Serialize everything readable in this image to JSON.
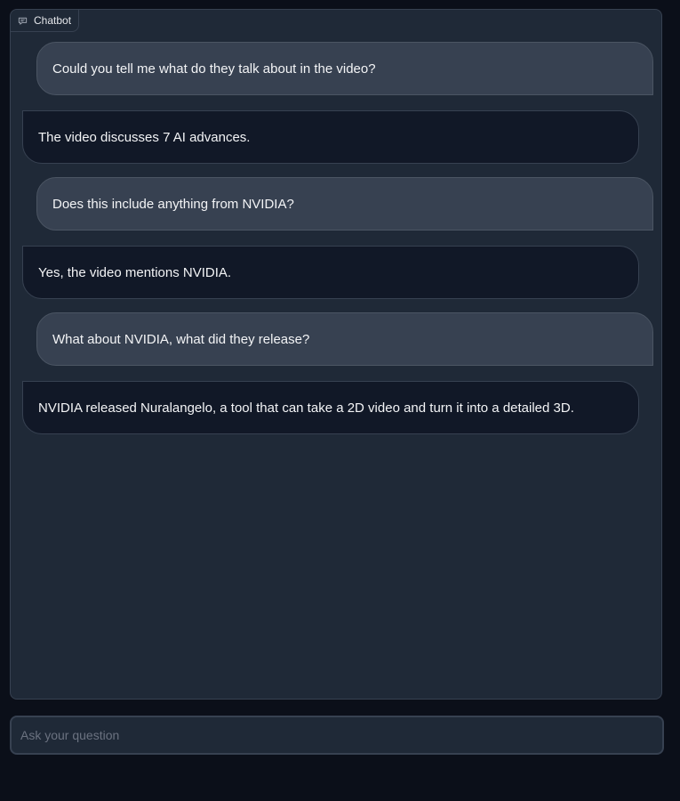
{
  "chatbot": {
    "label": "Chatbot",
    "icon": "chat-icon",
    "messages": [
      {
        "role": "user",
        "text": "Could you tell me what do they talk about in the video?"
      },
      {
        "role": "bot",
        "text": "The video discusses 7 AI advances."
      },
      {
        "role": "user",
        "text": "Does this include anything from NVIDIA?"
      },
      {
        "role": "bot",
        "text": "Yes, the video mentions NVIDIA."
      },
      {
        "role": "user",
        "text": "What about NVIDIA, what did they release?"
      },
      {
        "role": "bot",
        "text": "NVIDIA released Nuralangelo, a tool that can take a 2D video and turn it into a detailed 3D."
      }
    ]
  },
  "input": {
    "placeholder": "Ask your question",
    "value": ""
  },
  "colors": {
    "page_background": "#0b0f19",
    "panel_background": "#1f2937",
    "user_bubble": "#374151",
    "bot_bubble": "#111827"
  }
}
